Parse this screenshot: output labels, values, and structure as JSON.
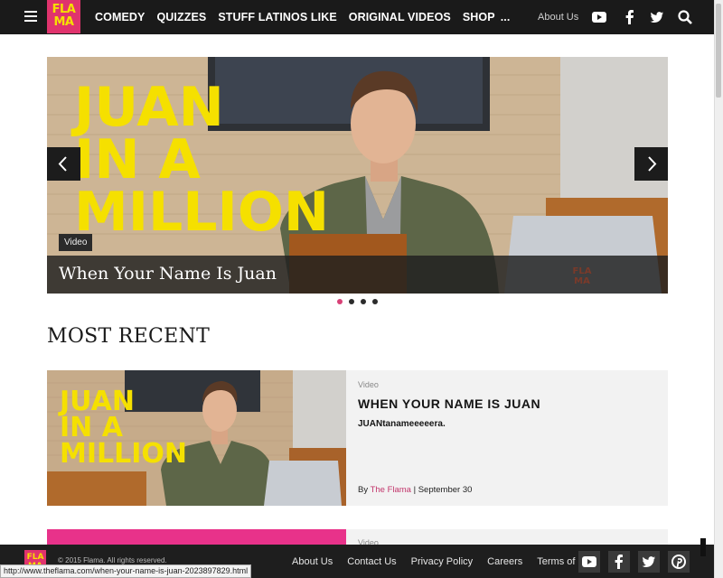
{
  "header": {
    "logo": {
      "line1": "FLA",
      "line2": "MA"
    },
    "nav": [
      {
        "label": "COMEDY"
      },
      {
        "label": "QUIZZES"
      },
      {
        "label": "STUFF LATINOS LIKE"
      },
      {
        "label": "ORIGINAL VIDEOS"
      },
      {
        "label": "SHOP"
      },
      {
        "label": "..."
      }
    ],
    "about_label": "About Us",
    "icons": [
      "youtube-icon",
      "facebook-icon",
      "twitter-icon",
      "search-icon"
    ]
  },
  "hero": {
    "art_lines": [
      "JUAN",
      "IN A",
      "MILLION"
    ],
    "watermark": {
      "line1": "FLA",
      "line2": "MA"
    },
    "badge": "Video",
    "title": "When Your Name Is Juan",
    "slide_count": 4,
    "active_slide": 1
  },
  "section": {
    "title": "MOST RECENT"
  },
  "articles": [
    {
      "category": "Video",
      "title": "WHEN YOUR NAME IS JUAN",
      "description": "JUANtanameeeeera.",
      "by": "By",
      "author": "The Flama",
      "separator": "|",
      "date": "September 30",
      "thumb_lines": [
        "JUAN",
        "IN A",
        "MILLION"
      ]
    },
    {
      "category": "Video"
    }
  ],
  "footer": {
    "logo": {
      "line1": "FLA",
      "line2": "MA"
    },
    "copyright": "© 2015 Flama. All rights reserved.",
    "links": [
      "About Us",
      "Contact Us",
      "Privacy Policy",
      "Careers",
      "Terms of Use"
    ],
    "icons": [
      "youtube-icon",
      "facebook-icon",
      "twitter-icon",
      "pinterest-icon"
    ]
  },
  "status_url": "http://www.theflama.com/when-your-name-is-juan-2023897829.html",
  "colors": {
    "brand_pink": "#e0336d",
    "brand_yellow": "#f5e000",
    "nav_bg": "#1a1a1a",
    "author_link": "#c2356b"
  }
}
